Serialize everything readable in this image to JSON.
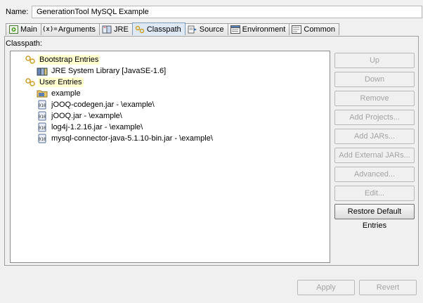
{
  "name_label": "Name:",
  "name_value": "GenerationTool MySQL Example",
  "tabs": [
    {
      "label": "Main",
      "icon": "main-tab-icon"
    },
    {
      "label": "Arguments",
      "icon": "arguments-icon"
    },
    {
      "label": "JRE",
      "icon": "jre-icon"
    },
    {
      "label": "Classpath",
      "icon": "classpath-icon",
      "active": true
    },
    {
      "label": "Source",
      "icon": "source-icon"
    },
    {
      "label": "Environment",
      "icon": "environment-icon"
    },
    {
      "label": "Common",
      "icon": "common-icon"
    }
  ],
  "classpath_label": "Classpath:",
  "tree": {
    "bootstrap": "Bootstrap Entries",
    "jre": "JRE System Library [JavaSE-1.6]",
    "user": "User Entries",
    "items": [
      "example",
      "jOOQ-codegen.jar - \\example\\",
      "jOOQ.jar - \\example\\",
      "log4j-1.2.16.jar - \\example\\",
      "mysql-connector-java-5.1.10-bin.jar - \\example\\"
    ]
  },
  "buttons": {
    "up": "Up",
    "down": "Down",
    "remove": "Remove",
    "add_projects": "Add Projects...",
    "add_jars": "Add JARs...",
    "add_external_jars": "Add External JARs...",
    "advanced": "Advanced...",
    "edit": "Edit...",
    "restore": "Restore Default Entries"
  },
  "apply": "Apply",
  "revert": "Revert",
  "colors": {
    "selection": "#fffdd0",
    "tab_active": "#dfe9f5"
  }
}
